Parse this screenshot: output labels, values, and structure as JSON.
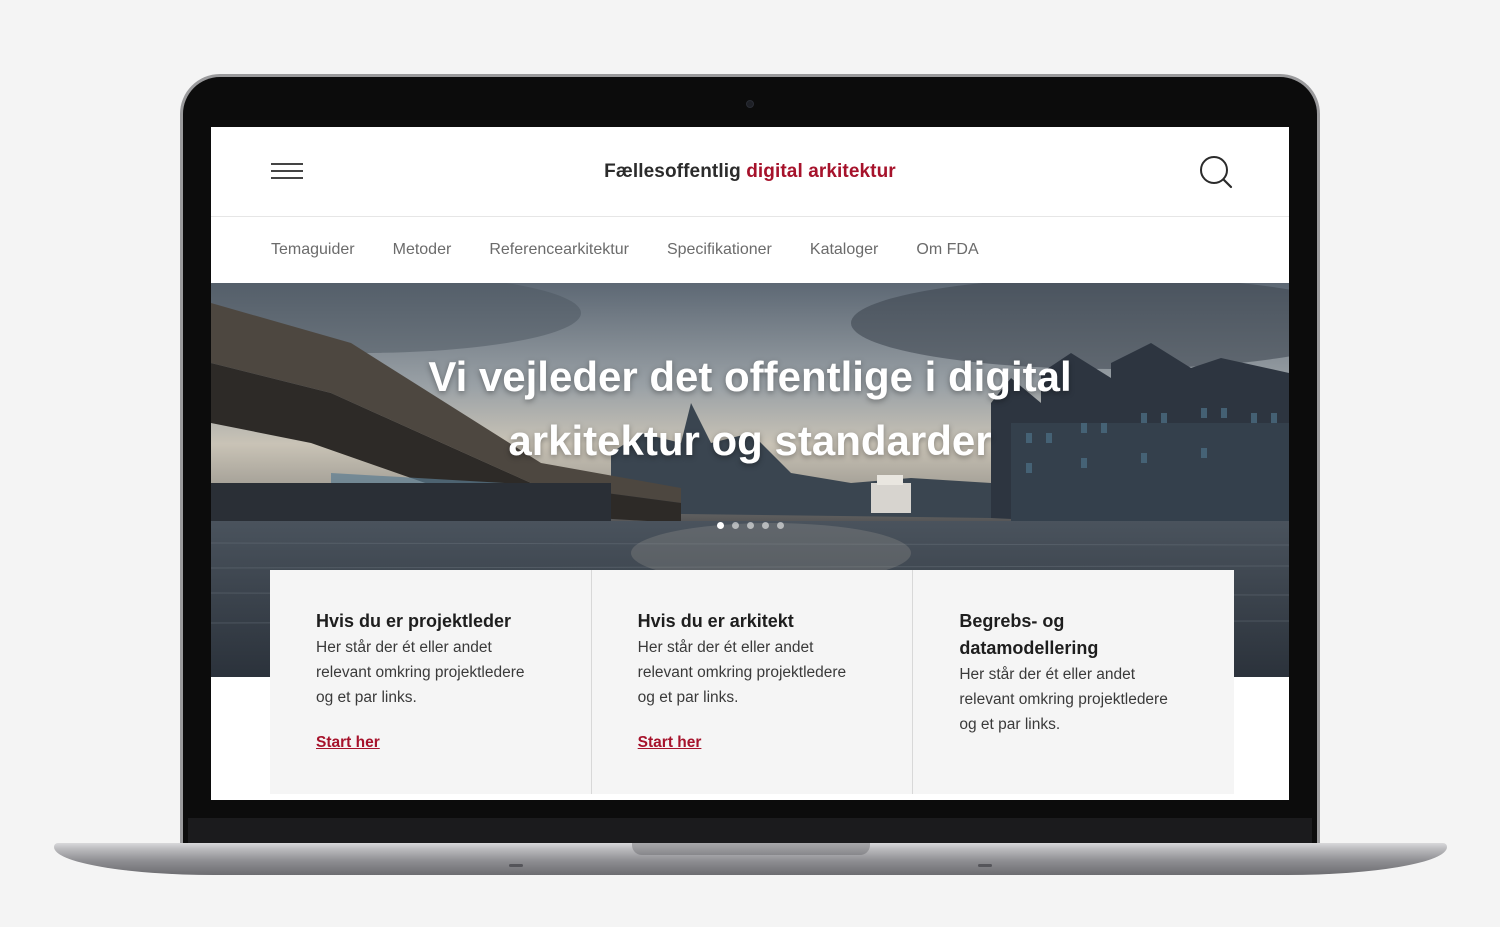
{
  "header": {
    "logo_prefix": "Fællesoffentlig",
    "logo_accent": "digital arkitektur",
    "menu_icon": "hamburger-menu-icon",
    "search_icon": "search-icon"
  },
  "nav": {
    "items": [
      "Temaguider",
      "Metoder",
      "Referencearkitektur",
      "Specifikationer",
      "Kataloger",
      "Om FDA"
    ]
  },
  "hero": {
    "title_line1": "Vi vejleder det offentlige i digital",
    "title_line2": "arkitektur og standarder",
    "slide_count": 5,
    "active_slide": 1
  },
  "cards": [
    {
      "title": "Hvis du er projektleder",
      "text": "Her står der ét eller andet relevant omkring projektledere og et par links.",
      "link": "Start her"
    },
    {
      "title": "Hvis du er arkitekt",
      "text": "Her står der ét eller andet relevant omkring projektledere og et par links.",
      "link": "Start her"
    },
    {
      "title": "Begrebs- og datamodellering",
      "text": "Her står der ét eller andet relevant omkring projektledere og et par links.",
      "link": ""
    }
  ],
  "colors": {
    "accent": "#a6122b",
    "text": "#2b2b2b",
    "nav_text": "#6b6b6b",
    "card_bg": "#f5f5f5"
  }
}
